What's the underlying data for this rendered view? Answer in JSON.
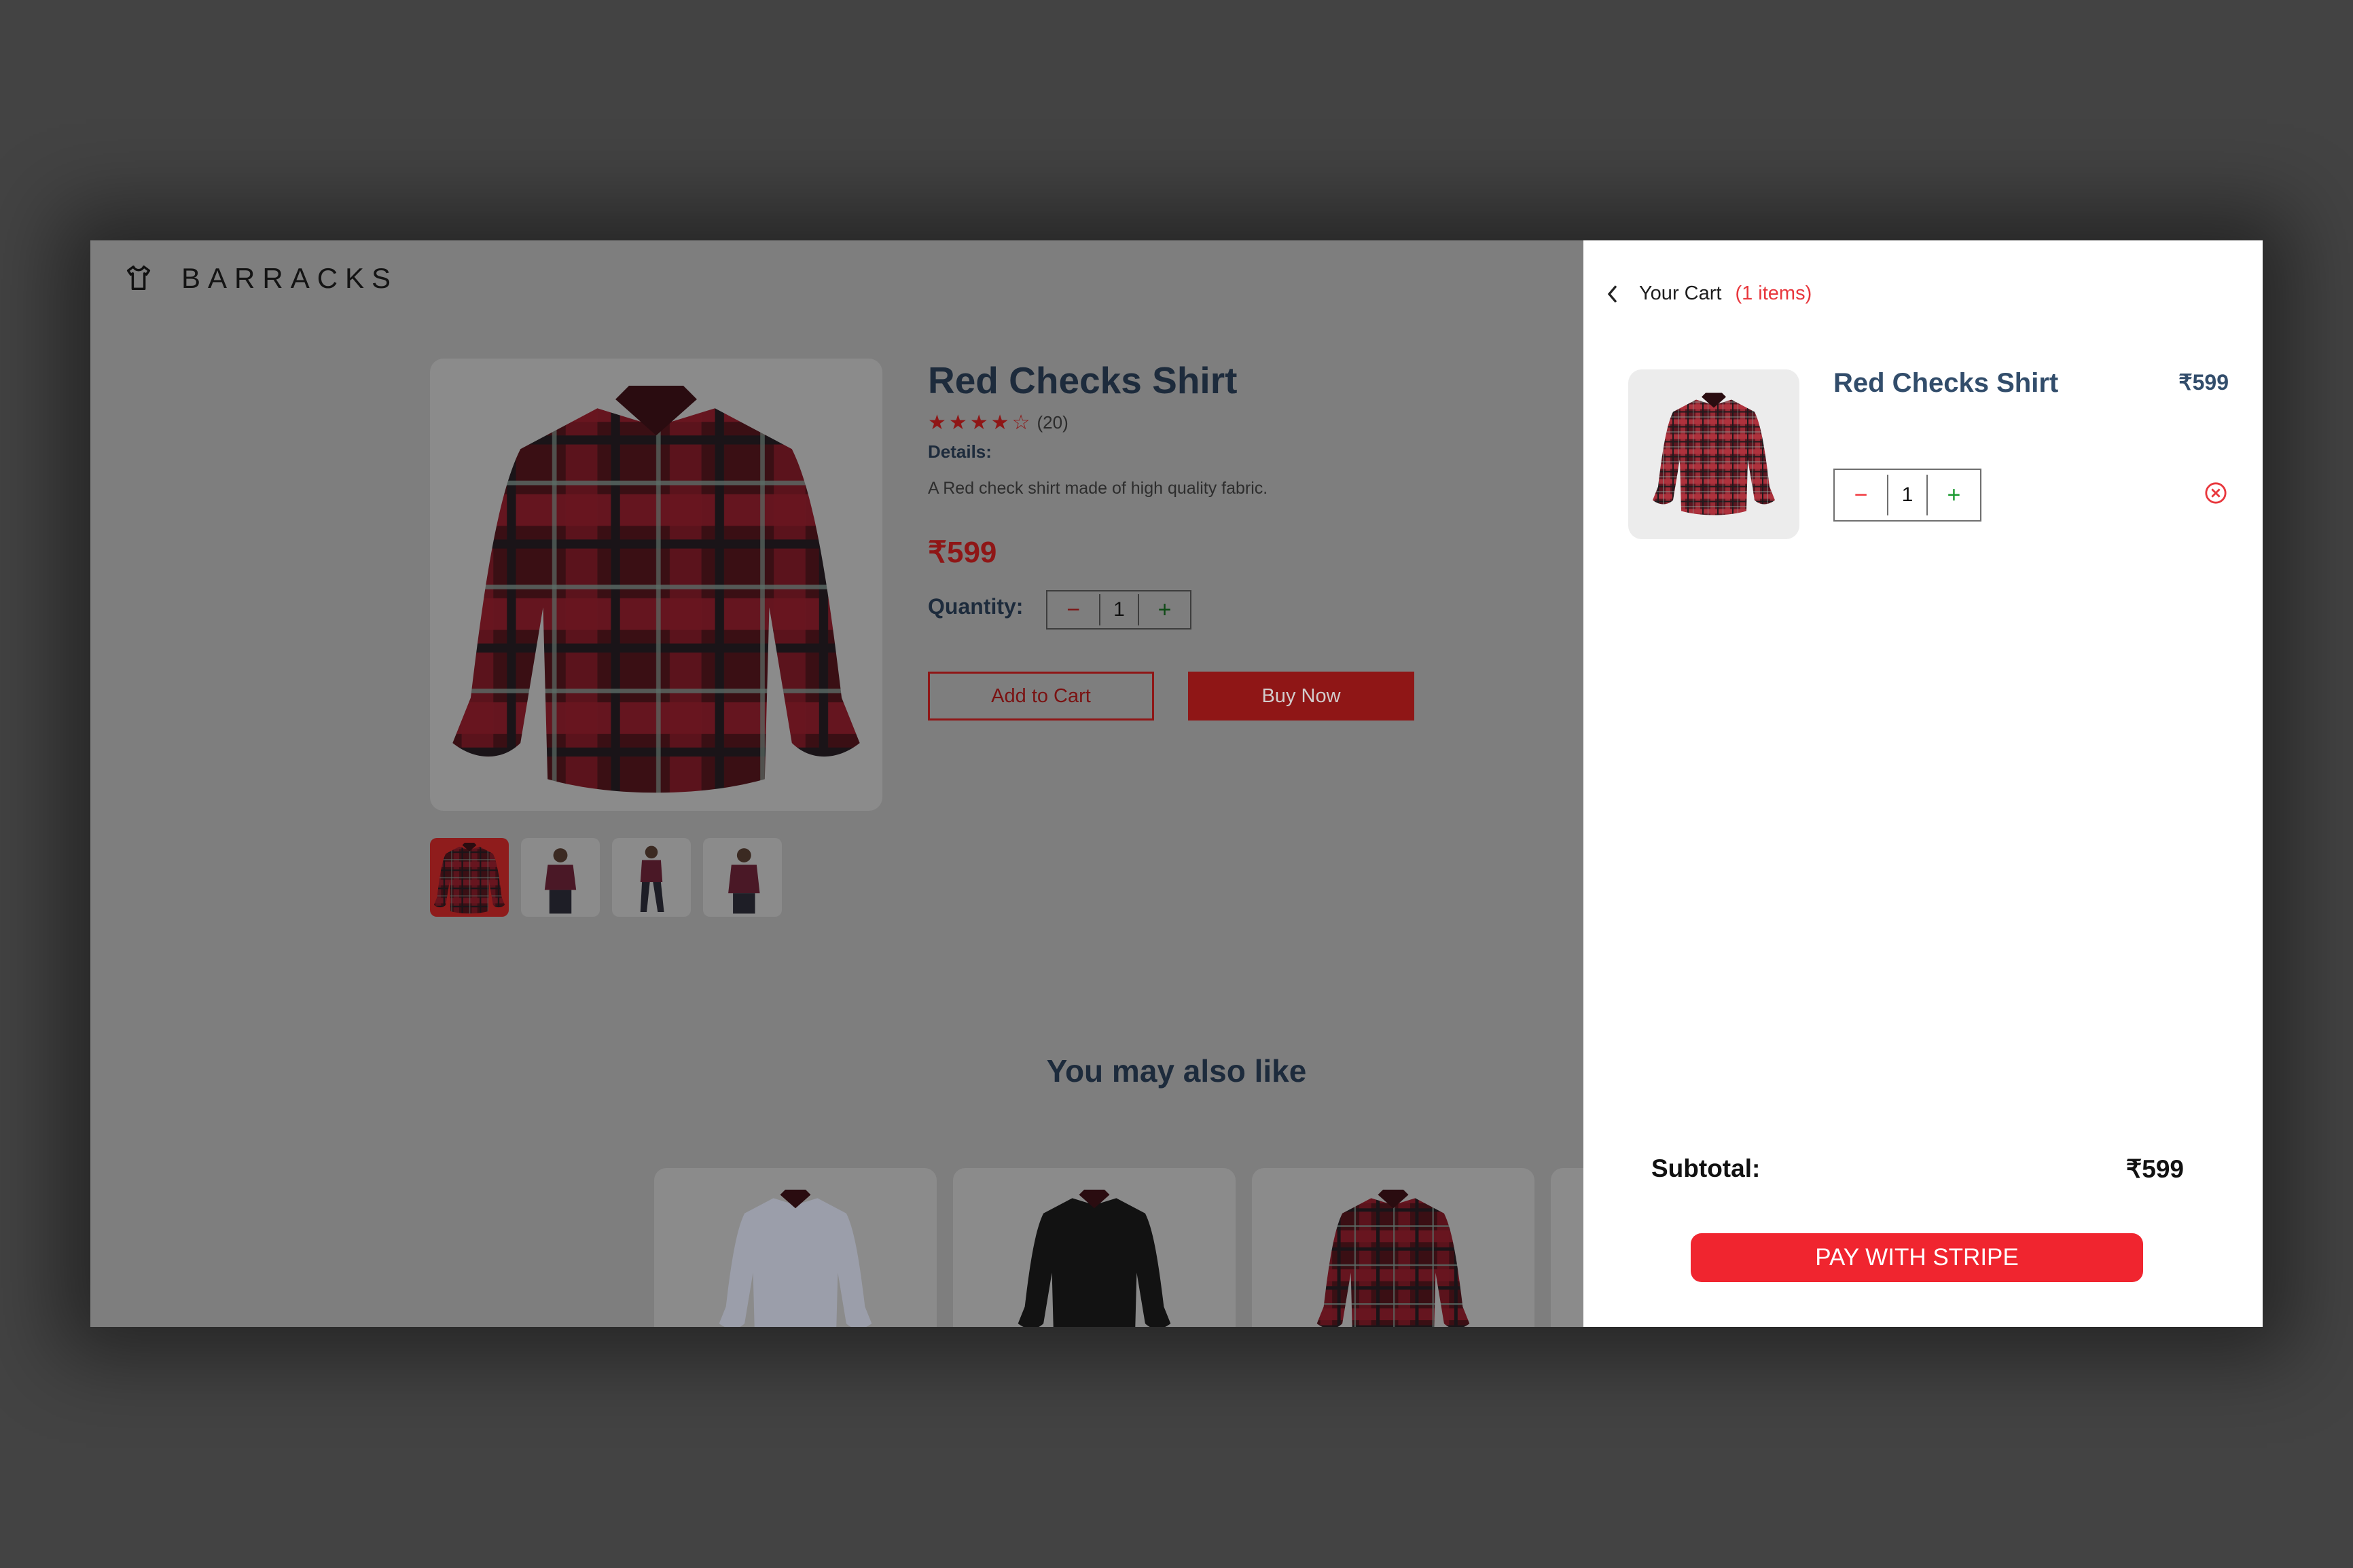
{
  "brand": {
    "name": "BARRACKS",
    "logo_icon": "tshirt-icon"
  },
  "product": {
    "title": "Red Checks Shirt",
    "stars": "★★★★☆",
    "rating_count": "(20)",
    "details_label": "Details:",
    "details_text": "A Red check shirt made of high quality fabric.",
    "price": "₹599",
    "quantity_label": "Quantity:",
    "quantity": "1",
    "minus": "−",
    "plus": "+",
    "add_to_cart": "Add to Cart",
    "buy_now": "Buy Now"
  },
  "recommendations": {
    "title": "You may also like"
  },
  "cart": {
    "title": "Your Cart",
    "count": "(1 items)",
    "item_name": "Red Checks Shirt",
    "item_price": "₹599",
    "item_quantity": "1",
    "minus": "−",
    "plus": "+",
    "subtotal_label": "Subtotal:",
    "subtotal_value": "₹599",
    "pay_button": "PAY WITH STRIPE"
  },
  "colors": {
    "accent": "#f0252f",
    "overlay_accent": "#8f1616",
    "title": "#324d6b"
  }
}
